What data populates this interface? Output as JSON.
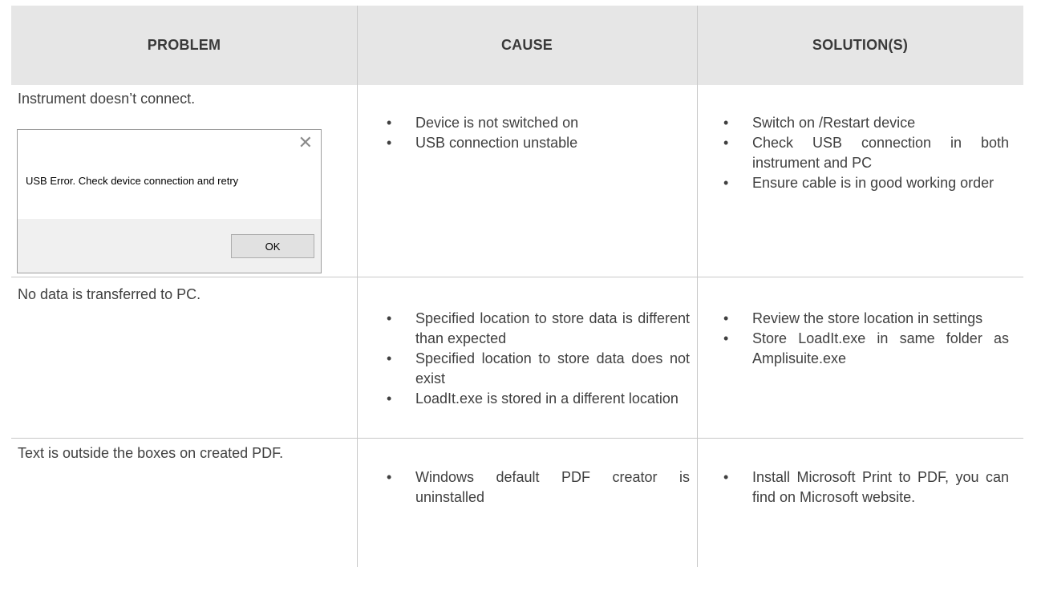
{
  "headers": {
    "problem": "PROBLEM",
    "cause": "CAUSE",
    "solutions": "SOLUTION(S)"
  },
  "rows": [
    {
      "problem": "Instrument doesn’t connect.",
      "causes": [
        "Device is not switched on",
        "USB connection unstable"
      ],
      "solutions": [
        "Switch on /Restart device",
        "Check USB connection in both instrument and PC",
        "Ensure cable is in good working order"
      ]
    },
    {
      "problem": "No data is transferred to PC.",
      "causes": [
        "Specified location to store data is different than expected",
        "Specified location to store data does not exist",
        "LoadIt.exe is stored in a different location"
      ],
      "solutions": [
        "Review the store location in settings",
        "Store LoadIt.exe in same folder as Amplisuite.exe"
      ]
    },
    {
      "problem": "Text is outside the boxes on created PDF.",
      "causes": [
        "Windows default PDF creator is uninstalled"
      ],
      "solutions": [
        "Install Microsoft Print to PDF, you can find on Microsoft website."
      ]
    }
  ],
  "dialog": {
    "close_icon": "close-icon",
    "message": "USB Error. Check device connection and retry",
    "ok_label": "OK"
  },
  "colors": {
    "header_bg": "#e6e6e6",
    "grid": "#c8c8c8",
    "text": "#404040"
  }
}
